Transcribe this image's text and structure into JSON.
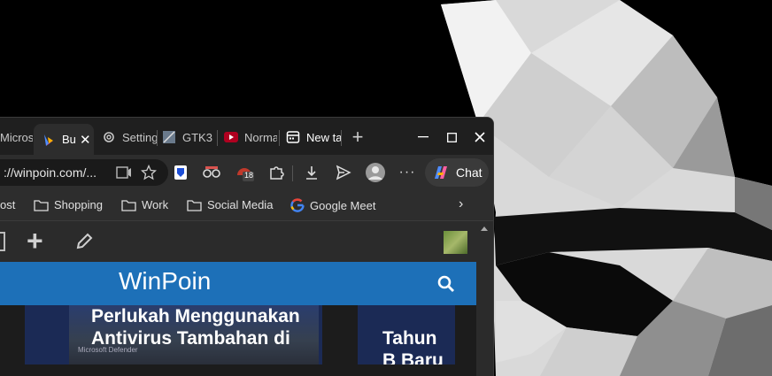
{
  "tabs": [
    {
      "label": "Micros"
    },
    {
      "label": "Bu",
      "active": true
    },
    {
      "label": "Setting"
    },
    {
      "label": "GTK3"
    },
    {
      "label": "Norma"
    },
    {
      "label": "New ta"
    }
  ],
  "address": {
    "url": "://winpoin.com/..."
  },
  "extensions": {
    "badge_count": "18"
  },
  "chat": {
    "label": "Chat"
  },
  "favorites": [
    {
      "label": "ost"
    },
    {
      "label": "Shopping"
    },
    {
      "label": "Work"
    },
    {
      "label": "Social Media"
    },
    {
      "label": "Google Meet"
    }
  ],
  "site": {
    "logo": "WinPoin",
    "card1_title": "Perlukah Menggunakan Antivirus Tambahan di",
    "card1_caption": "Microsoft Defender",
    "card2_title": "Tahun B Baru Re"
  },
  "colors": {
    "site_header": "#1d70b8",
    "chat_gradient_start": "#4f8cff",
    "chat_gradient_end": "#ff5fa2"
  }
}
